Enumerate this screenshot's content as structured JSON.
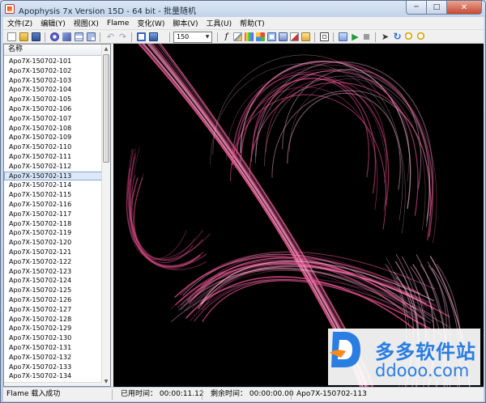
{
  "window": {
    "title": "Apophysis 7x Version 15D  - 64 bit - 批量随机"
  },
  "menu": [
    "文件(Z)",
    "编辑(Y)",
    "视图(X)",
    "Flame",
    "变化(W)",
    "脚本(V)",
    "工具(U)",
    "帮助(T)"
  ],
  "toolbar": {
    "quality_value": "150",
    "icons": [
      "new-icon",
      "open-icon",
      "save-icon",
      "gear-icon",
      "script-icon",
      "list-view-icon",
      "grid-view-icon",
      "undo-icon",
      "redo-icon",
      "fullscreen-icon",
      "preview-icon",
      "formula-icon",
      "edit-icon",
      "gradient-icon",
      "mutate-icon",
      "adjust-icon",
      "export-icon",
      "render-icon",
      "transform-icon",
      "image-icon",
      "script-edit-icon",
      "play-icon",
      "stop-icon",
      "pointer-icon",
      "rotate-icon",
      "zoom-in-icon",
      "zoom-out-icon"
    ]
  },
  "list": {
    "header": "名称",
    "items": [
      "Apo7X-150702-101",
      "Apo7X-150702-102",
      "Apo7X-150702-103",
      "Apo7X-150702-104",
      "Apo7X-150702-105",
      "Apo7X-150702-106",
      "Apo7X-150702-107",
      "Apo7X-150702-108",
      "Apo7X-150702-109",
      "Apo7X-150702-110",
      "Apo7X-150702-111",
      "Apo7X-150702-112",
      "Apo7X-150702-113",
      "Apo7X-150702-114",
      "Apo7X-150702-115",
      "Apo7X-150702-116",
      "Apo7X-150702-117",
      "Apo7X-150702-118",
      "Apo7X-150702-119",
      "Apo7X-150702-120",
      "Apo7X-150702-121",
      "Apo7X-150702-122",
      "Apo7X-150702-123",
      "Apo7X-150702-124",
      "Apo7X-150702-125",
      "Apo7X-150702-126",
      "Apo7X-150702-127",
      "Apo7X-150702-128",
      "Apo7X-150702-129",
      "Apo7X-150702-130",
      "Apo7X-150702-131",
      "Apo7X-150702-132",
      "Apo7X-150702-133",
      "Apo7X-150702-134"
    ],
    "selected": "Apo7X-150702-113"
  },
  "watermark": {
    "title": "多多软件站",
    "url": "ddooo.com"
  },
  "status": {
    "message": "Flame 载入成功",
    "elapsed": "已用时间： 00:00:11.12",
    "remaining": "剩余时间： 00:00:00.00",
    "flame_name": "Apo7X-150702-113"
  },
  "colors": {
    "fractal": "#e8508e",
    "fractal_light": "#ffb8d6",
    "accent": "#2a7de1"
  }
}
